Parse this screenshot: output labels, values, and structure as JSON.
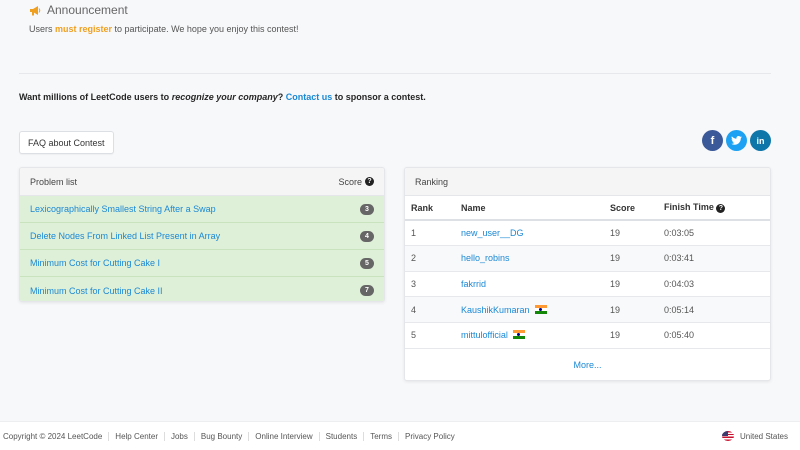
{
  "announcement": {
    "title": "Announcement",
    "text_before": "Users ",
    "text_highlight": "must register",
    "text_after": " to participate. We hope you enjoy this contest!",
    "icon": "megaphone-icon",
    "highlight_color": "#f0a020"
  },
  "sponsor": {
    "part1": "Want millions of LeetCode users to ",
    "emphasis": "recognize your company",
    "part2": "? ",
    "link": "Contact us",
    "part3": " to sponsor a contest."
  },
  "faq_button": "FAQ about Contest",
  "social": {
    "facebook": "f",
    "twitter": "t",
    "linkedin": "in"
  },
  "problems": {
    "header": "Problem list",
    "score_header": "Score",
    "items": [
      {
        "title": "Lexicographically Smallest String After a Swap",
        "score": "3"
      },
      {
        "title": "Delete Nodes From Linked List Present in Array",
        "score": "4"
      },
      {
        "title": "Minimum Cost for Cutting Cake I",
        "score": "5"
      },
      {
        "title": "Minimum Cost for Cutting Cake II",
        "score": "7"
      }
    ]
  },
  "ranking": {
    "header": "Ranking",
    "columns": [
      "Rank",
      "Name",
      "Score",
      "Finish Time"
    ],
    "rows": [
      {
        "rank": "1",
        "name": "new_user__DG",
        "score": "19",
        "time": "0:03:05",
        "flag": ""
      },
      {
        "rank": "2",
        "name": "hello_robins",
        "score": "19",
        "time": "0:03:41",
        "flag": ""
      },
      {
        "rank": "3",
        "name": "fakrrid",
        "score": "19",
        "time": "0:04:03",
        "flag": ""
      },
      {
        "rank": "4",
        "name": "KaushikKumaran",
        "score": "19",
        "time": "0:05:14",
        "flag": "india-flag-icon"
      },
      {
        "rank": "5",
        "name": "mittulofficial",
        "score": "19",
        "time": "0:05:40",
        "flag": "india-flag-icon"
      }
    ],
    "more": "More..."
  },
  "footer": {
    "copyright": "Copyright © 2024 LeetCode",
    "links": [
      "Help Center",
      "Jobs",
      "Bug Bounty",
      "Online Interview",
      "Students",
      "Terms",
      "Privacy Policy"
    ],
    "region": "United States"
  }
}
